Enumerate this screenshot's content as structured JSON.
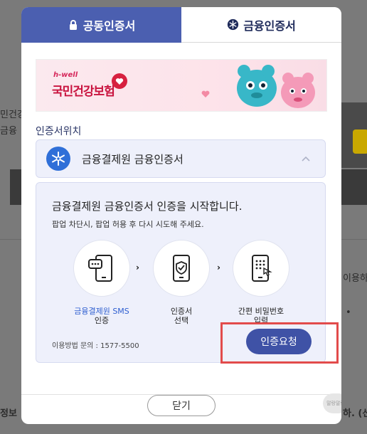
{
  "background": {
    "fragments": [
      "민건강",
      "금융",
      "이용하",
      "정보",
      "하. (선택"
    ],
    "dot": "•"
  },
  "tabs": [
    {
      "label": "공동인증서",
      "icon": "lock-icon",
      "active": true
    },
    {
      "label": "금융인증서",
      "icon": "finance-cert-icon",
      "active": false
    }
  ],
  "banner": {
    "brand_small": "h-well",
    "brand_name": "국민건강보험"
  },
  "section_label": "인증서위치",
  "accordion": {
    "title": "금융결제원 금융인증서",
    "chevron": "chevron-up-icon"
  },
  "panel": {
    "title": "금융결제원 금융인증서 인증을 시작합니다.",
    "subtitle": "팝업 차단시, 팝업 허용 후 다시 시도해 주세요.",
    "steps": [
      {
        "line1": "금융결제원 SMS",
        "line2": "인증",
        "icon": "phone-sms-icon"
      },
      {
        "line1": "인증서",
        "line2": "선택",
        "icon": "phone-shield-icon"
      },
      {
        "line1": "간편 비밀번호",
        "line2": "입력",
        "icon": "phone-keypad-icon"
      }
    ],
    "arrow": "›",
    "inquiry": "이용방법 문의 : 1577-5500",
    "auth_button": "인증요청"
  },
  "close_button": "닫기",
  "watermark": "말랑말랑",
  "colors": {
    "accent": "#4b5fb0",
    "button": "#3f52a6",
    "highlight": "#e24b4b"
  }
}
